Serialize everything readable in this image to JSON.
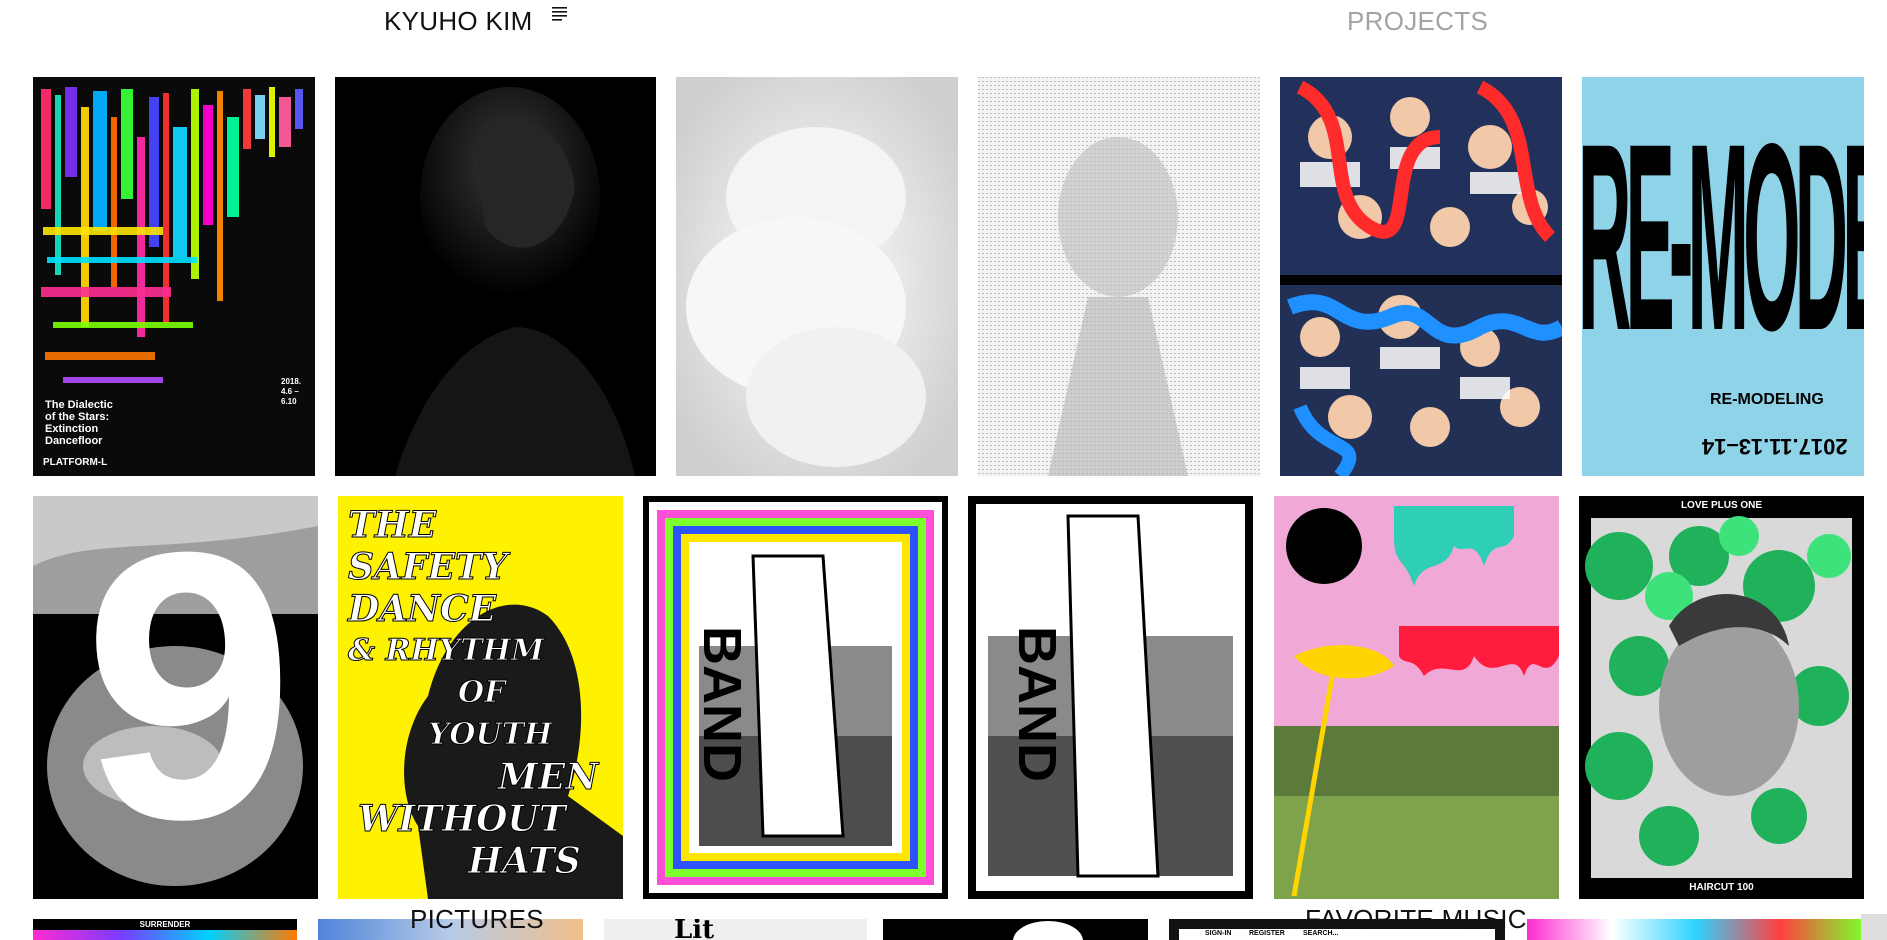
{
  "header": {
    "site_title": "KYUHO KIM",
    "menu_icon": "menu-lines-icon",
    "projects_label": "PROJECTS"
  },
  "footer_nav": {
    "pictures_label": "PICTURES",
    "music_label": "FAVORITE MUSIC"
  },
  "posters": {
    "dialectic": {
      "headline": "THE DIALECTIC OF THE STARS",
      "subtitle_1": "The Dialectic",
      "subtitle_2": "of the Stars:",
      "subtitle_3": "Extinction",
      "subtitle_4": "Dancefloor",
      "venue": "PLATFORM-L",
      "date_1": "2018.",
      "date_2": "4.6 –",
      "date_3": "6.10"
    },
    "remodeling": {
      "big": "RE-MODELING",
      "sub": "RE-MODELING",
      "date": "2017.11.13–14"
    },
    "safety_dance": {
      "line_1": "THE",
      "line_2": "SAFETY",
      "line_3": "DANCE",
      "line_4": "& RHYTHM",
      "line_5": "OF",
      "line_6": "YOUTH",
      "line_7": "MEN",
      "line_8": "WITHOUT",
      "line_9": "HATS"
    },
    "band_1": {
      "word": "BAND"
    },
    "band_2": {
      "word": "BAND"
    },
    "haircut": {
      "top": "LOVE PLUS ONE",
      "bottom": "HAIRCUT 100"
    },
    "nine": {
      "numeral": "9"
    },
    "surrender": {
      "label": "SURRENDER"
    },
    "lit": {
      "label": "Lit"
    },
    "sign": {
      "signin": "SIGN-IN",
      "register": "REGISTER",
      "search": "SEARCH..."
    }
  }
}
